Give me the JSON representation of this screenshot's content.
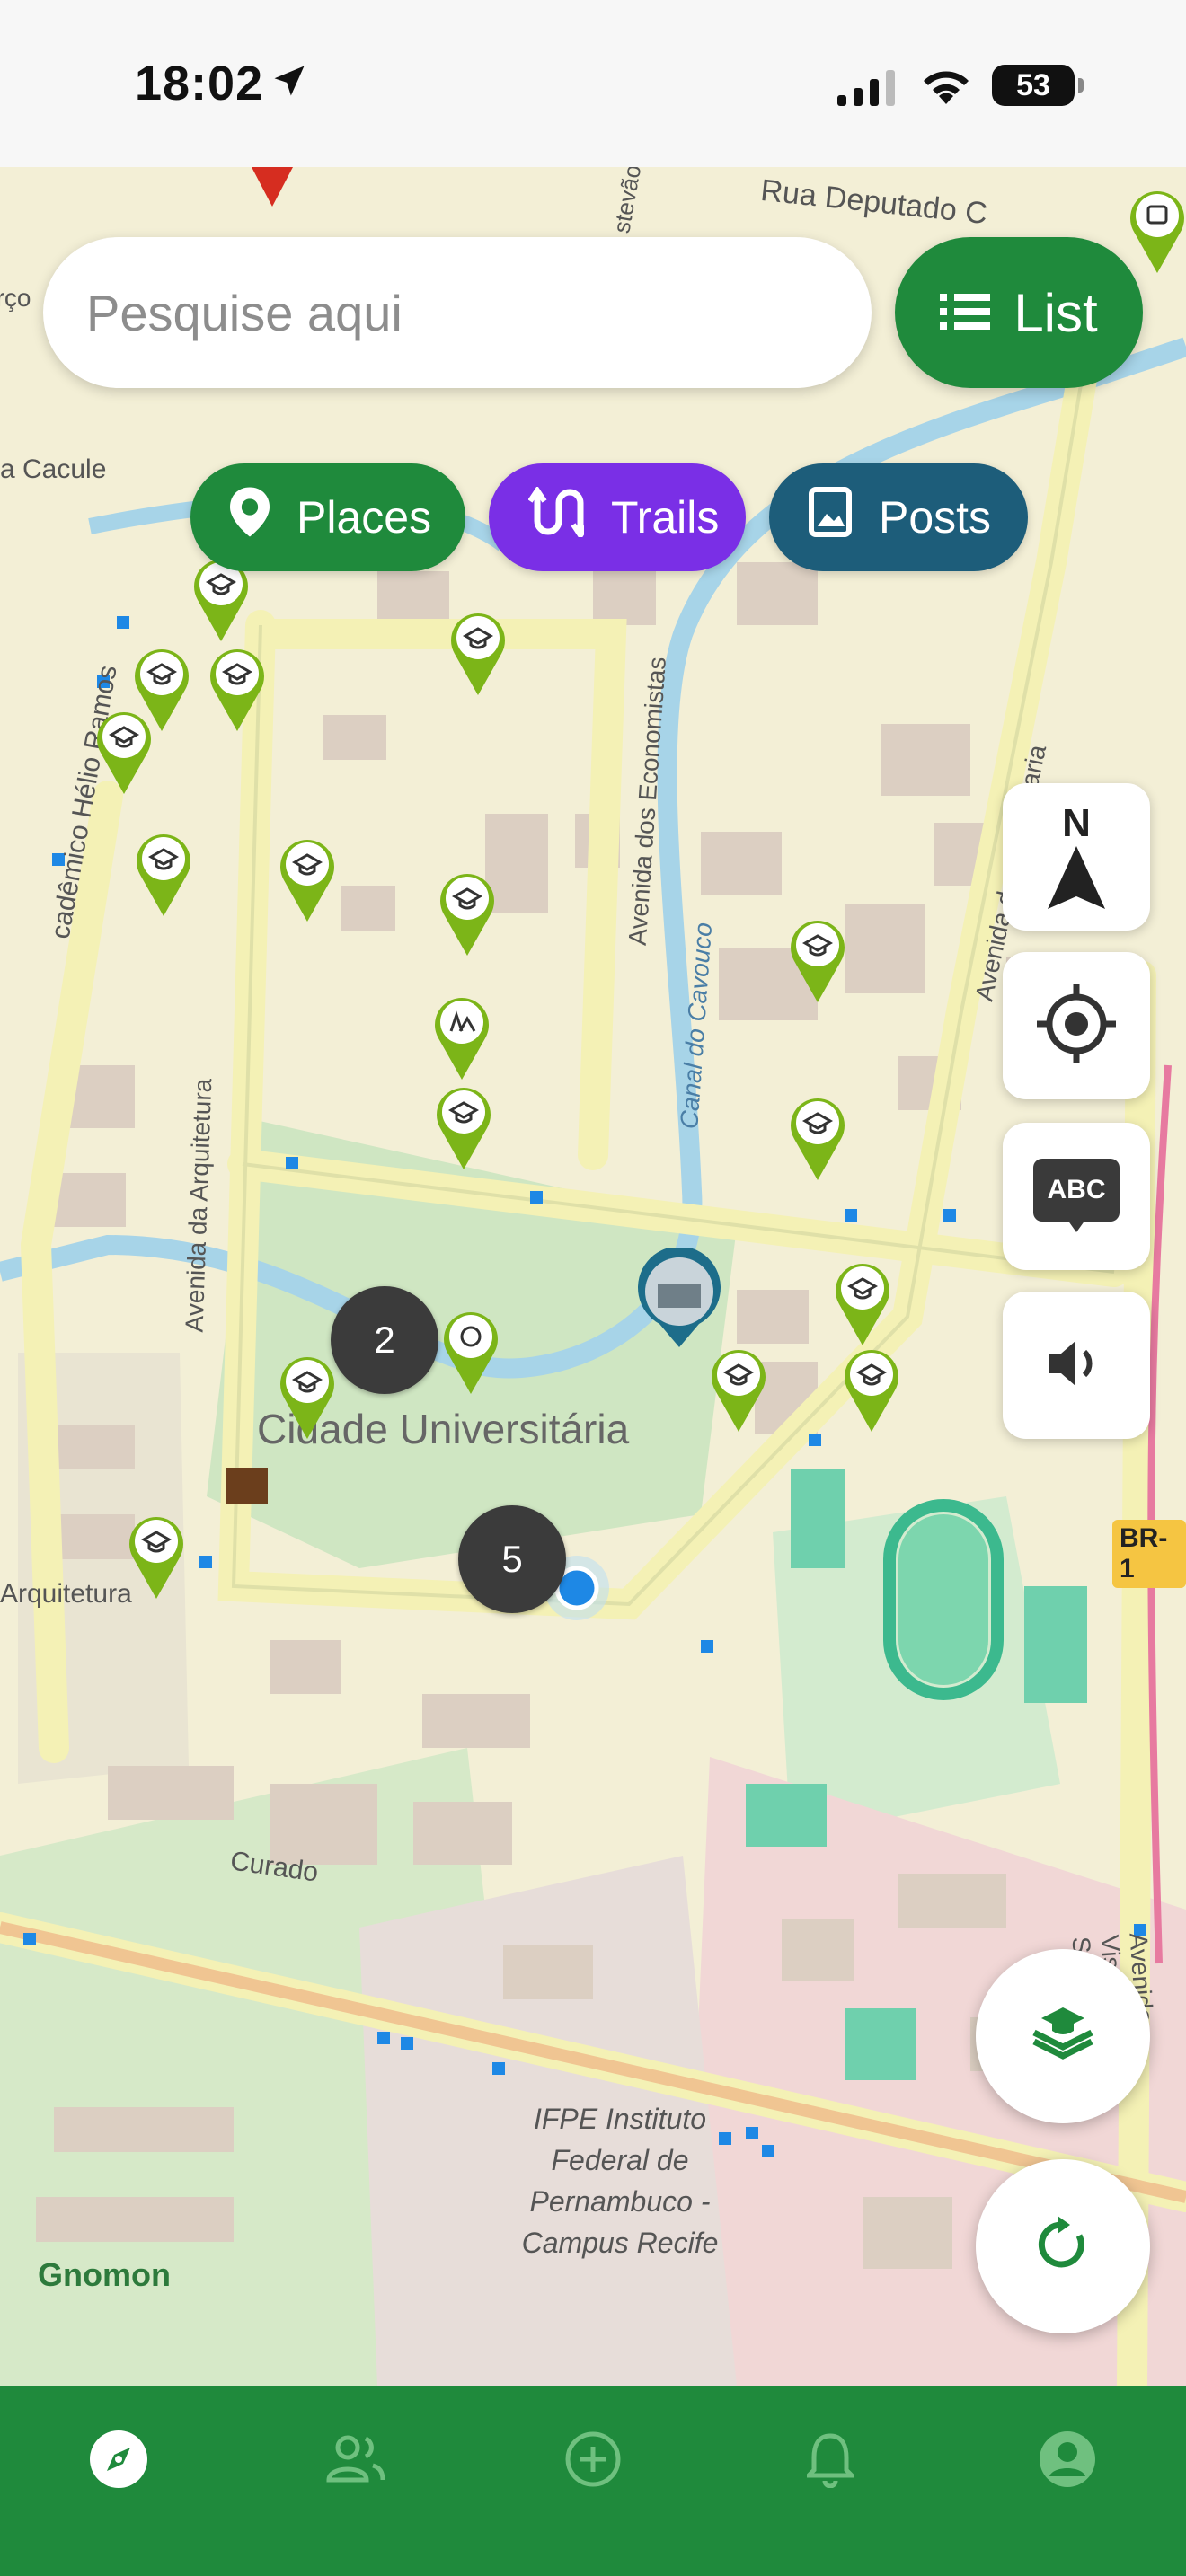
{
  "status_bar": {
    "time": "18:02",
    "battery": "53",
    "icons": [
      "location-arrow-icon",
      "signal-icon",
      "wifi-icon",
      "battery-icon"
    ]
  },
  "search": {
    "placeholder": "Pesquise aqui",
    "value": ""
  },
  "list_button": {
    "label": "List",
    "icon": "list-icon"
  },
  "filters": [
    {
      "label": "Places",
      "icon": "map-pin-icon",
      "color": "#1f8a3c"
    },
    {
      "label": "Trails",
      "icon": "route-icon",
      "color": "#7a2fe6"
    },
    {
      "label": "Posts",
      "icon": "image-post-icon",
      "color": "#1d5d7a"
    }
  ],
  "map_controls": {
    "compass_label": "N",
    "labels_toggle": "ABC",
    "icons": [
      "compass-north-icon",
      "my-location-icon",
      "labels-icon",
      "sound-icon"
    ]
  },
  "clusters": {
    "left": "2",
    "bottom": "5"
  },
  "map_labels": {
    "cidade": "Cidade Universitária",
    "rua_deputado": "Rua Deputado C",
    "cacule": "a Cacule",
    "helio_ramos": "cadêmico Hélio Ramos",
    "economistas": "Avenida dos Economistas",
    "engenharia": "Avenida da Engenharia",
    "arquitetura_av": "Avenida da Arquitetura",
    "arquitetura": "Arquitetura",
    "cavouco": "Canal do Cavouco",
    "curado": "Curado",
    "ifpe": "IFPE Instituto Federal de Pernambuco - Campus Recife",
    "visconde": "Avenida Visconde de Sa",
    "br": "BR-1",
    "estevao": "stevão",
    "marco": "arço"
  },
  "map_attribution": "Gnomon",
  "fabs": [
    "layers-graduation-icon",
    "refresh-icon"
  ],
  "bottom_nav": [
    {
      "name": "explore",
      "icon": "compass-icon",
      "active": true
    },
    {
      "name": "community",
      "icon": "people-icon",
      "active": false
    },
    {
      "name": "create",
      "icon": "add-circle-icon",
      "active": false
    },
    {
      "name": "notifications",
      "icon": "bell-icon",
      "active": false
    },
    {
      "name": "profile",
      "icon": "account-icon",
      "active": false
    }
  ],
  "colors": {
    "primary_green": "#1f8a3c",
    "pin_green": "#7cb518",
    "trails_purple": "#7a2fe6",
    "posts_blue": "#1d5d7a",
    "cluster_gray": "#3b3b3b"
  }
}
